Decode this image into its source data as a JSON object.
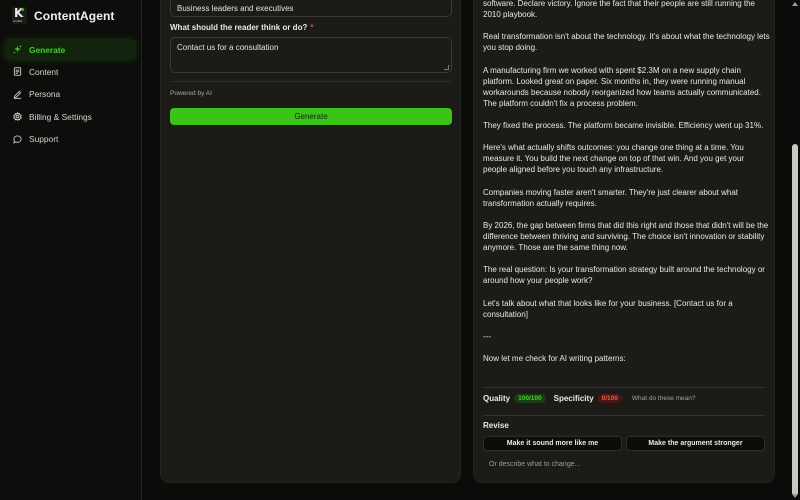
{
  "brand": {
    "name": "ContentAgent",
    "logo_letter": "K",
    "logo_tiny": "AGEN"
  },
  "sidebar": {
    "items": [
      {
        "label": "Generate",
        "icon": "sparkle-icon",
        "active": true
      },
      {
        "label": "Content",
        "icon": "document-icon",
        "active": false
      },
      {
        "label": "Persona",
        "icon": "pen-icon",
        "active": false
      },
      {
        "label": "Billing & Settings",
        "icon": "gear-icon",
        "active": false
      },
      {
        "label": "Support",
        "icon": "chat-bubble-icon",
        "active": false
      }
    ]
  },
  "form": {
    "audience_value": "Business leaders and executives",
    "question_label": "What should the reader think or do?",
    "required_mark": "*",
    "cta_value": "Contact us for a consultation",
    "powered_by": "Powered by AI",
    "generate_label": "Generate"
  },
  "article": {
    "paragraphs": [
      "software. Declare victory. Ignore the fact that their people are still running the 2010 playbook.",
      "Real transformation isn't about the technology. It's about what the technology lets you stop doing.",
      "A manufacturing firm we worked with spent $2.3M on a new supply chain platform. Looked great on paper. Six months in, they were running manual workarounds because nobody reorganized how teams actually communicated. The platform couldn't fix a process problem.",
      "They fixed the process. The platform became invisible. Efficiency went up 31%.",
      "Here's what actually shifts outcomes: you change one thing at a time. You measure it. You build the next change on top of that win. And you get your people aligned before you touch any infrastructure.",
      "Companies moving faster aren't smarter. They're just clearer about what transformation actually requires.",
      "By 2026, the gap between firms that did this right and those that didn't will be the difference between thriving and surviving. The choice isn't innovation or stability anymore. Those are the same thing now.",
      "The real question: Is your transformation strategy built around the technology or around how your people work?",
      "Let's talk about what that looks like for your business. [Contact us for a consultation]",
      "---",
      "Now let me check for AI writing patterns:"
    ]
  },
  "quality": {
    "quality_label": "Quality",
    "quality_score": "100/100",
    "specificity_label": "Specificity",
    "specificity_score": "0/100",
    "help_link": "What do these mean?"
  },
  "revise": {
    "title": "Revise",
    "button_1": "Make it sound more like me",
    "button_2": "Make the argument stronger",
    "input_placeholder": "Or describe what to change..."
  },
  "colors": {
    "accent": "#3ac418",
    "good": "#4ad233",
    "bad": "#ef5a50",
    "required": "#e0443a"
  }
}
